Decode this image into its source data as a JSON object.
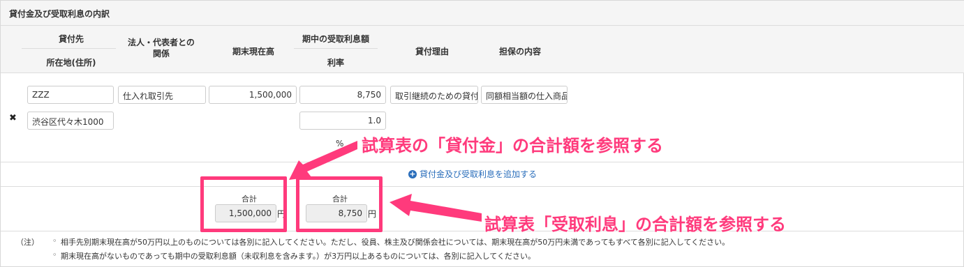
{
  "section": {
    "title": "貸付金及び受取利息の内訳"
  },
  "headers": {
    "borrower": "貸付先",
    "address": "所在地(住所)",
    "relation": "法人・代表者との\n関係",
    "balance": "期末現在高",
    "interest": "期中の受取利息額",
    "rate": "利率",
    "reason": "貸付理由",
    "collateral": "担保の内容"
  },
  "row": {
    "borrower_name": "ZZZ",
    "address": "渋谷区代々木1000",
    "relation": "仕入れ取引先",
    "balance": "1,500,000",
    "interest": "8,750",
    "rate": "1.0",
    "rate_unit": "%",
    "reason": "取引継続のための貸付",
    "collateral": "同額相当額の仕入商品"
  },
  "add_link": "貸付金及び受取利息を追加する",
  "totals": {
    "label_balance": "合計",
    "balance": "1,500,000",
    "label_interest": "合計",
    "interest": "8,750",
    "unit": "円"
  },
  "annotations": {
    "loan_total": "試算表の「貸付金」の合計額を参照する",
    "interest_total": "試算表「受取利息」の合計額を参照する"
  },
  "notes": {
    "label": "（注）",
    "bullet": "◦",
    "line1": "相手先別期末現在高が50万円以上のものについては各別に記入してください。ただし、役員、株主及び関係会社については、期末現在高が50万円未満であってもすべて各別に記入してください。",
    "line2": "期末現在高がないものであっても期中の受取利息額（未収利息を含みます。）が3万円以上あるものについては、各別に記入してください。"
  },
  "colors": {
    "highlight": "#ff3a7c",
    "link": "#2a6ebb"
  }
}
